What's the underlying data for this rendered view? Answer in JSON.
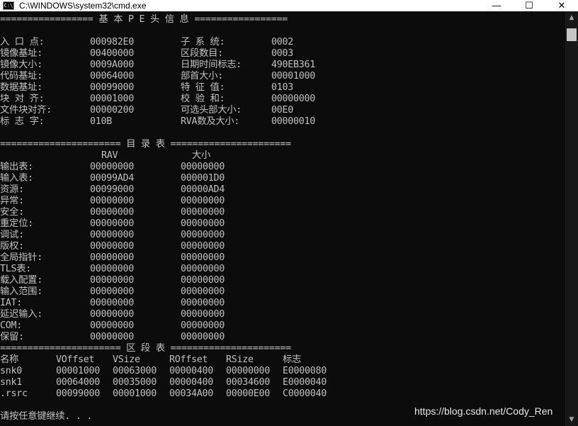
{
  "window": {
    "title": "C:\\WINDOWS\\system32\\cmd.exe",
    "icon_text": "C:\\",
    "minimize_icon": "minimize-icon",
    "maximize_icon": "maximize-icon",
    "close_icon": "close-icon",
    "minimize_glyph": "—",
    "maximize_glyph": "☐",
    "close_glyph": "✕"
  },
  "pe_header": {
    "banner": "================= 基 本 P E 头 信 息 =================",
    "rows": [
      [
        "入 口 点:",
        "000982E0",
        "子 系 统:",
        "0002"
      ],
      [
        "镜像基址:",
        "00400000",
        "区段数目:",
        "0003"
      ],
      [
        "镜像大小:",
        "0009A000",
        "日期时间标志:",
        "490EB361"
      ],
      [
        "代码基址:",
        "00064000",
        "部首大小:",
        "00001000"
      ],
      [
        "数据基址:",
        "00099000",
        "特 征 值:",
        "0103"
      ],
      [
        "块 对 齐:",
        "00001000",
        "校 验 和:",
        "00000000"
      ],
      [
        "文件块对齐:",
        "00000200",
        "可选头部大小:",
        "00E0"
      ],
      [
        "标 志 字:",
        "010B",
        "RVA数及大小:",
        "00000010"
      ]
    ]
  },
  "directory": {
    "banner": "====================== 目 录 表 ======================",
    "col_rav": "RAV",
    "col_size": "大小",
    "rows": [
      [
        "输出表:",
        "00000000",
        "00000000"
      ],
      [
        "输入表:",
        "00099AD4",
        "000001D0"
      ],
      [
        "资源:",
        "00099000",
        "00000AD4"
      ],
      [
        "异常:",
        "00000000",
        "00000000"
      ],
      [
        "安全:",
        "00000000",
        "00000000"
      ],
      [
        "重定位:",
        "00000000",
        "00000000"
      ],
      [
        "调试:",
        "00000000",
        "00000000"
      ],
      [
        "版权:",
        "00000000",
        "00000000"
      ],
      [
        "全局指针:",
        "00000000",
        "00000000"
      ],
      [
        "TLS表:",
        "00000000",
        "00000000"
      ],
      [
        "载入配置:",
        "00000000",
        "00000000"
      ],
      [
        "输入范围:",
        "00000000",
        "00000000"
      ],
      [
        "IAT:",
        "00000000",
        "00000000"
      ],
      [
        "延迟输入:",
        "00000000",
        "00000000"
      ],
      [
        "COM:",
        "00000000",
        "00000000"
      ],
      [
        "保留:",
        "00000000",
        "00000000"
      ]
    ]
  },
  "sections": {
    "banner": "====================== 区 段 表 ======================",
    "headers": [
      "名称",
      "VOffset",
      "VSize",
      "ROffset",
      "RSize",
      "标志"
    ],
    "rows": [
      [
        "snk0",
        "00001000",
        "00063000",
        "00000400",
        "00000000",
        "E0000080"
      ],
      [
        "snk1",
        "00064000",
        "00035000",
        "00000400",
        "00034600",
        "E0000040"
      ],
      [
        ".rsrc",
        "00099000",
        "00001000",
        "00034A00",
        "00000E00",
        "C0000040"
      ]
    ]
  },
  "prompt": "请按任意键继续. . .",
  "watermark": "https://blog.csdn.net/Cody_Ren",
  "scrollbar": {
    "up_glyph": "▲",
    "down_glyph": "▼"
  },
  "colors": {
    "background": "#0c0c0c",
    "text": "#c0c0c0",
    "titlebar": "#ffffff"
  }
}
